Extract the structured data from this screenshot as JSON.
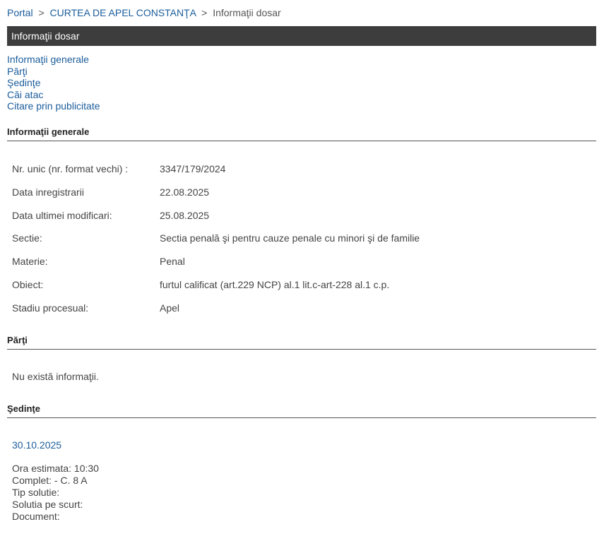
{
  "breadcrumb": {
    "portal": "Portal",
    "court": "CURTEA DE APEL CONSTANŢA",
    "current": "Informaţii dosar",
    "separator": ">"
  },
  "header": {
    "title": "Informaţii dosar"
  },
  "toc": [
    "Informaţii generale",
    "Părţi",
    "Şedinţe",
    "Căi atac",
    "Citare prin publicitate"
  ],
  "general": {
    "heading": "Informaţii generale",
    "rows": [
      {
        "label": "Nr. unic (nr. format vechi) :",
        "value": "3347/179/2024"
      },
      {
        "label": "Data inregistrarii",
        "value": "22.08.2025"
      },
      {
        "label": "Data ultimei modificari:",
        "value": "25.08.2025"
      },
      {
        "label": "Sectie:",
        "value": "Sectia penală şi pentru cauze penale cu minori şi de familie"
      },
      {
        "label": "Materie:",
        "value": "Penal"
      },
      {
        "label": "Obiect:",
        "value": "furtul calificat (art.229 NCP) al.1 lit.c-art-228 al.1 c.p."
      },
      {
        "label": "Stadiu procesual:",
        "value": "Apel"
      }
    ]
  },
  "parti": {
    "heading": "Părţi",
    "empty_text": "Nu există informaţii."
  },
  "sedinte": {
    "heading": "Şedinţe",
    "date": "30.10.2025",
    "details": [
      "Ora estimata: 10:30",
      "Complet: - C. 8 A",
      "Tip solutie:",
      "Solutia pe scurt:",
      "Document:"
    ]
  },
  "colors": {
    "link": "#1c5d9c",
    "title_bar": "#3d3d3d",
    "text": "#444444"
  }
}
